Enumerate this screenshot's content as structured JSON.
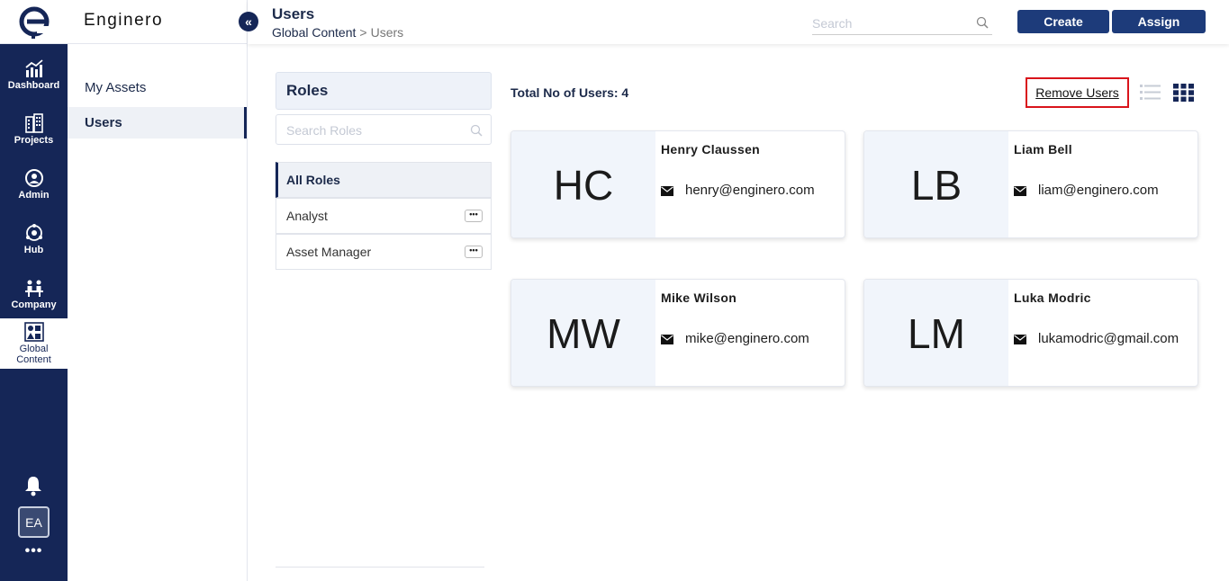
{
  "app": {
    "brand": "Enginero",
    "logo_letter": "e"
  },
  "rail": {
    "items": [
      {
        "label": "Dashboard",
        "icon": "dashboard-chart-icon"
      },
      {
        "label": "Projects",
        "icon": "buildings-icon"
      },
      {
        "label": "Admin",
        "icon": "admin-user-icon"
      },
      {
        "label": "Hub",
        "icon": "hub-network-icon"
      },
      {
        "label": "Company",
        "icon": "company-people-icon"
      },
      {
        "label_line1": "Global",
        "label_line2": "Content",
        "icon": "global-content-icon",
        "active": true
      }
    ],
    "avatar": "EA",
    "more": "•••"
  },
  "sidebar": {
    "collapse_glyph": "«",
    "items": [
      {
        "label": "My Assets",
        "active": false
      },
      {
        "label": "Users",
        "active": true
      }
    ]
  },
  "header": {
    "title": "Users",
    "breadcrumb": {
      "root": "Global Content",
      "separator": ">",
      "current": "Users"
    },
    "search_placeholder": "Search",
    "create_label": "Create",
    "assign_label": "Assign"
  },
  "roles": {
    "title": "Roles",
    "search_placeholder": "Search Roles",
    "items": [
      {
        "label": "All Roles",
        "active": true
      },
      {
        "label": "Analyst",
        "more": "•••"
      },
      {
        "label": "Asset Manager",
        "more": "•••"
      }
    ]
  },
  "main": {
    "total_label": "Total No of Users: 4",
    "remove_users_label": "Remove Users",
    "users": [
      {
        "initials": "HC",
        "name": "Henry Claussen",
        "email": "henry@enginero.com"
      },
      {
        "initials": "LB",
        "name": "Liam Bell",
        "email": "liam@enginero.com"
      },
      {
        "initials": "MW",
        "name": "Mike Wilson",
        "email": "mike@enginero.com"
      },
      {
        "initials": "LM",
        "name": "Luka Modric",
        "email": "lukamodric@gmail.com"
      }
    ]
  },
  "colors": {
    "navy": "#152657",
    "button": "#1d3b7a",
    "highlight_red": "#d9141b",
    "card_left": "#f1f5fb"
  }
}
